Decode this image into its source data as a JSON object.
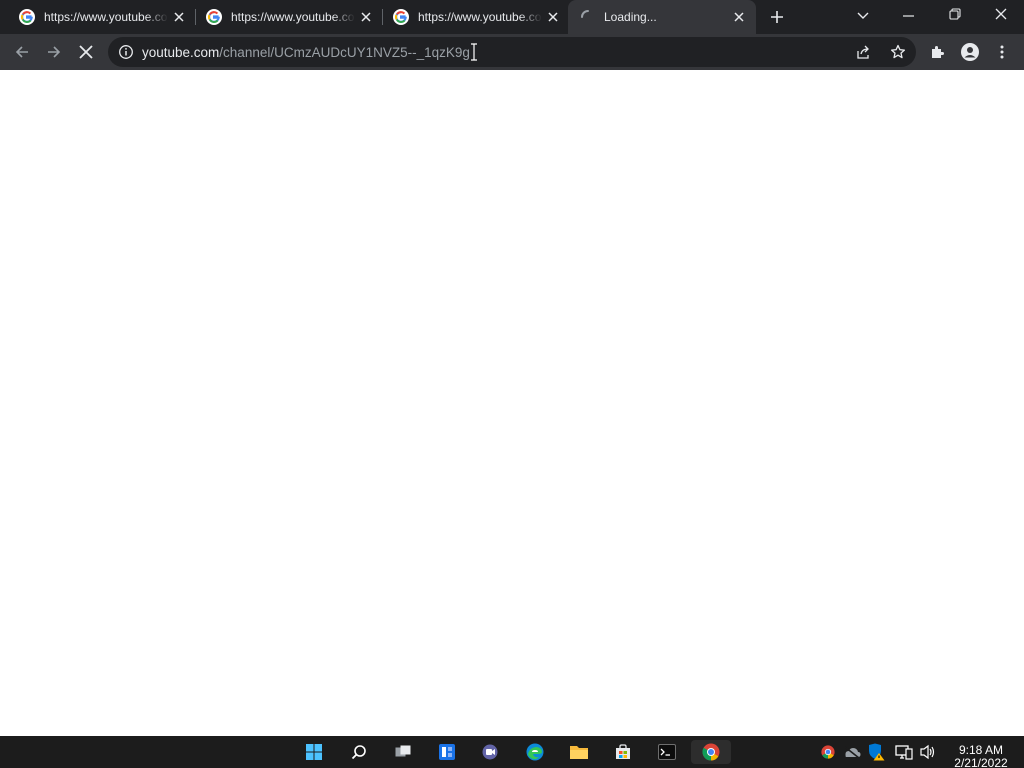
{
  "browser": {
    "tabs": [
      {
        "title": "https://www.youtube.com/",
        "favicon": "google-g-icon",
        "state": "loaded"
      },
      {
        "title": "https://www.youtube.com/",
        "favicon": "google-g-icon",
        "state": "loaded"
      },
      {
        "title": "https://www.youtube.com/",
        "favicon": "google-g-icon",
        "state": "loaded"
      },
      {
        "title": "Loading...",
        "favicon": "loading-spinner-icon",
        "state": "loading",
        "active": true
      }
    ],
    "new_tab_icon": "plus-icon",
    "window_controls": [
      "tab-search-icon",
      "minimize-icon",
      "restore-icon",
      "close-icon"
    ],
    "toolbar": {
      "back_icon": "back-arrow-icon",
      "forward_icon": "forward-arrow-icon",
      "stop_icon": "stop-icon",
      "site_info_icon": "info-icon",
      "url_host": "youtube.com",
      "url_path": "/channel/UCmzAUDcUY1NVZ5--_1qzK9g",
      "right_icons": [
        "share-icon",
        "bookmark-star-icon",
        "extensions-icon",
        "profile-icon",
        "menu-icon"
      ]
    },
    "colors": {
      "frame": "#202124",
      "toolbar": "#35363a",
      "omnibox": "#202124",
      "page": "#ffffff"
    }
  },
  "taskbar": {
    "apps": [
      "windows-start-icon",
      "search-icon",
      "task-view-icon",
      "widgets-icon",
      "teams-chat-icon",
      "edge-icon",
      "file-explorer-icon",
      "store-icon",
      "terminal-icon",
      "chrome-icon"
    ],
    "active_app": "chrome-icon",
    "tray_icons": [
      "chrome-tray-icon",
      "onedrive-offline-icon",
      "defender-warning-icon",
      "network-icon",
      "volume-icon"
    ],
    "time": "9:18 AM",
    "date": "2/21/2022"
  }
}
